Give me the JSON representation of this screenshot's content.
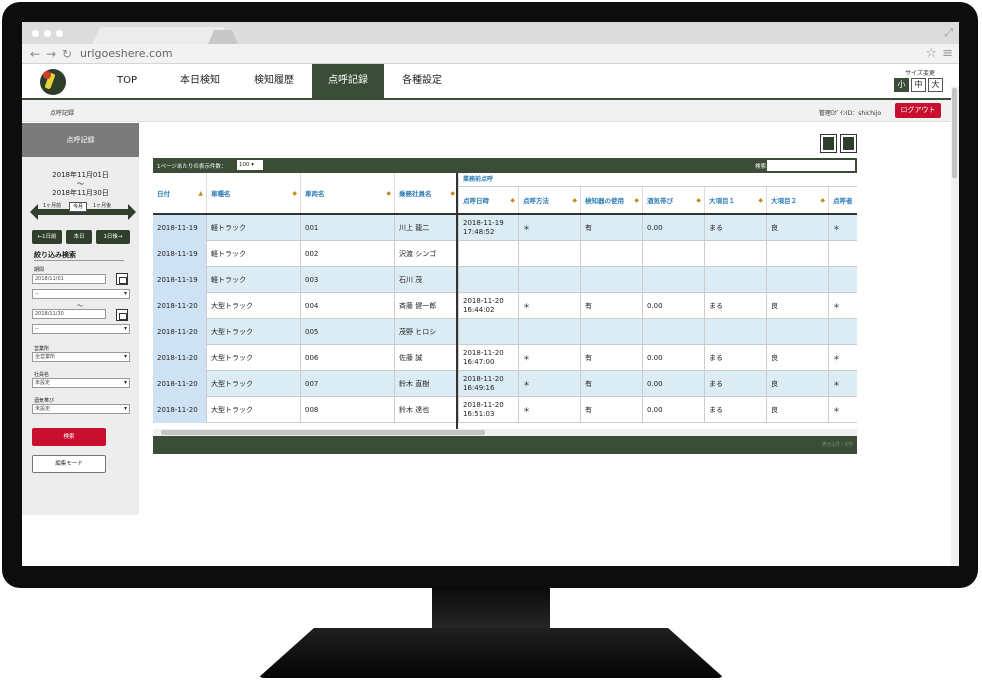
{
  "browser": {
    "url": "urlgoeshere.com"
  },
  "nav": {
    "items": [
      "TOP",
      "本日検知",
      "検知履歴",
      "点呼記録",
      "各種設定"
    ],
    "size_label": "サイズ変更",
    "sizes": [
      "小",
      "中",
      "大"
    ]
  },
  "subheader": {
    "breadcrumb": "点呼記録",
    "admin_id": "管理ﾛｸﾞｲﾝID：shichijo",
    "logout": "ログアウト"
  },
  "sidebar": {
    "title": "点呼記録",
    "date_from": "2018年11月01日",
    "date_sep": "～",
    "date_to": "2018年11月30日",
    "prev_month": "1ヶ月前",
    "this_month": "今月",
    "next_month": "1ヶ月後",
    "prev_day": "←1日前",
    "today": "本日",
    "next_day": "1日後→",
    "filter_title": "絞り込み検索",
    "period_label": "期間",
    "period_from": "2018/11/01",
    "period_from_time": "--",
    "period_sep": "～",
    "period_to": "2018/11/30",
    "period_to_time": "--",
    "office_label": "営業所",
    "office_value": "全営業所",
    "company_label": "社員名",
    "company_value": "未設定",
    "alcohol_label": "酒気帯び",
    "alcohol_value": "未設定",
    "search_btn": "検索",
    "edit_btn": "編集モード"
  },
  "table": {
    "per_page_label": "1ページあたりの表示件数：",
    "per_page_value": "100",
    "search_label": "検索:",
    "group_header": "業務前点呼",
    "columns": [
      "日付",
      "車種名",
      "車両名",
      "乗務社員名",
      "点呼日時",
      "点呼方法",
      "検知器の使用",
      "酒気帯び",
      "大項目１",
      "大項目２",
      "点呼者"
    ],
    "rows": [
      [
        "2018-11-19",
        "軽トラック",
        "001",
        "川上 龍二",
        "2018-11-19 17:48:52",
        "＊",
        "有",
        "0.00",
        "まる",
        "良",
        "＊"
      ],
      [
        "2018-11-19",
        "軽トラック",
        "002",
        "沢渡 シンゴ",
        "",
        "",
        "",
        "",
        "",
        "",
        ""
      ],
      [
        "2018-11-19",
        "軽トラック",
        "003",
        "石川 茂",
        "",
        "",
        "",
        "",
        "",
        "",
        ""
      ],
      [
        "2018-11-20",
        "大型トラック",
        "004",
        "斉藤 健一郎",
        "2018-11-20 16:44:02",
        "＊",
        "有",
        "0.00",
        "まる",
        "良",
        "＊"
      ],
      [
        "2018-11-20",
        "大型トラック",
        "005",
        "茂野 ヒロシ",
        "",
        "",
        "",
        "",
        "",
        "",
        ""
      ],
      [
        "2018-11-20",
        "大型トラック",
        "006",
        "佐藤 誠",
        "2018-11-20 16:47:00",
        "＊",
        "有",
        "0.00",
        "まる",
        "良",
        "＊"
      ],
      [
        "2018-11-20",
        "大型トラック",
        "007",
        "鈴木 直樹",
        "2018-11-20 16:49:16",
        "＊",
        "有",
        "0.00",
        "まる",
        "良",
        "＊"
      ],
      [
        "2018-11-20",
        "大型トラック",
        "008",
        "鈴木 達也",
        "2018-11-20 16:51:03",
        "＊",
        "有",
        "0.00",
        "まる",
        "良",
        "＊"
      ]
    ],
    "info": "表示1件 / 8件"
  },
  "colors": {
    "brand": "#3b4d37",
    "accent_red": "#c8102e",
    "link_blue": "#2d7cb5",
    "row_blue": "#dcecf4"
  }
}
